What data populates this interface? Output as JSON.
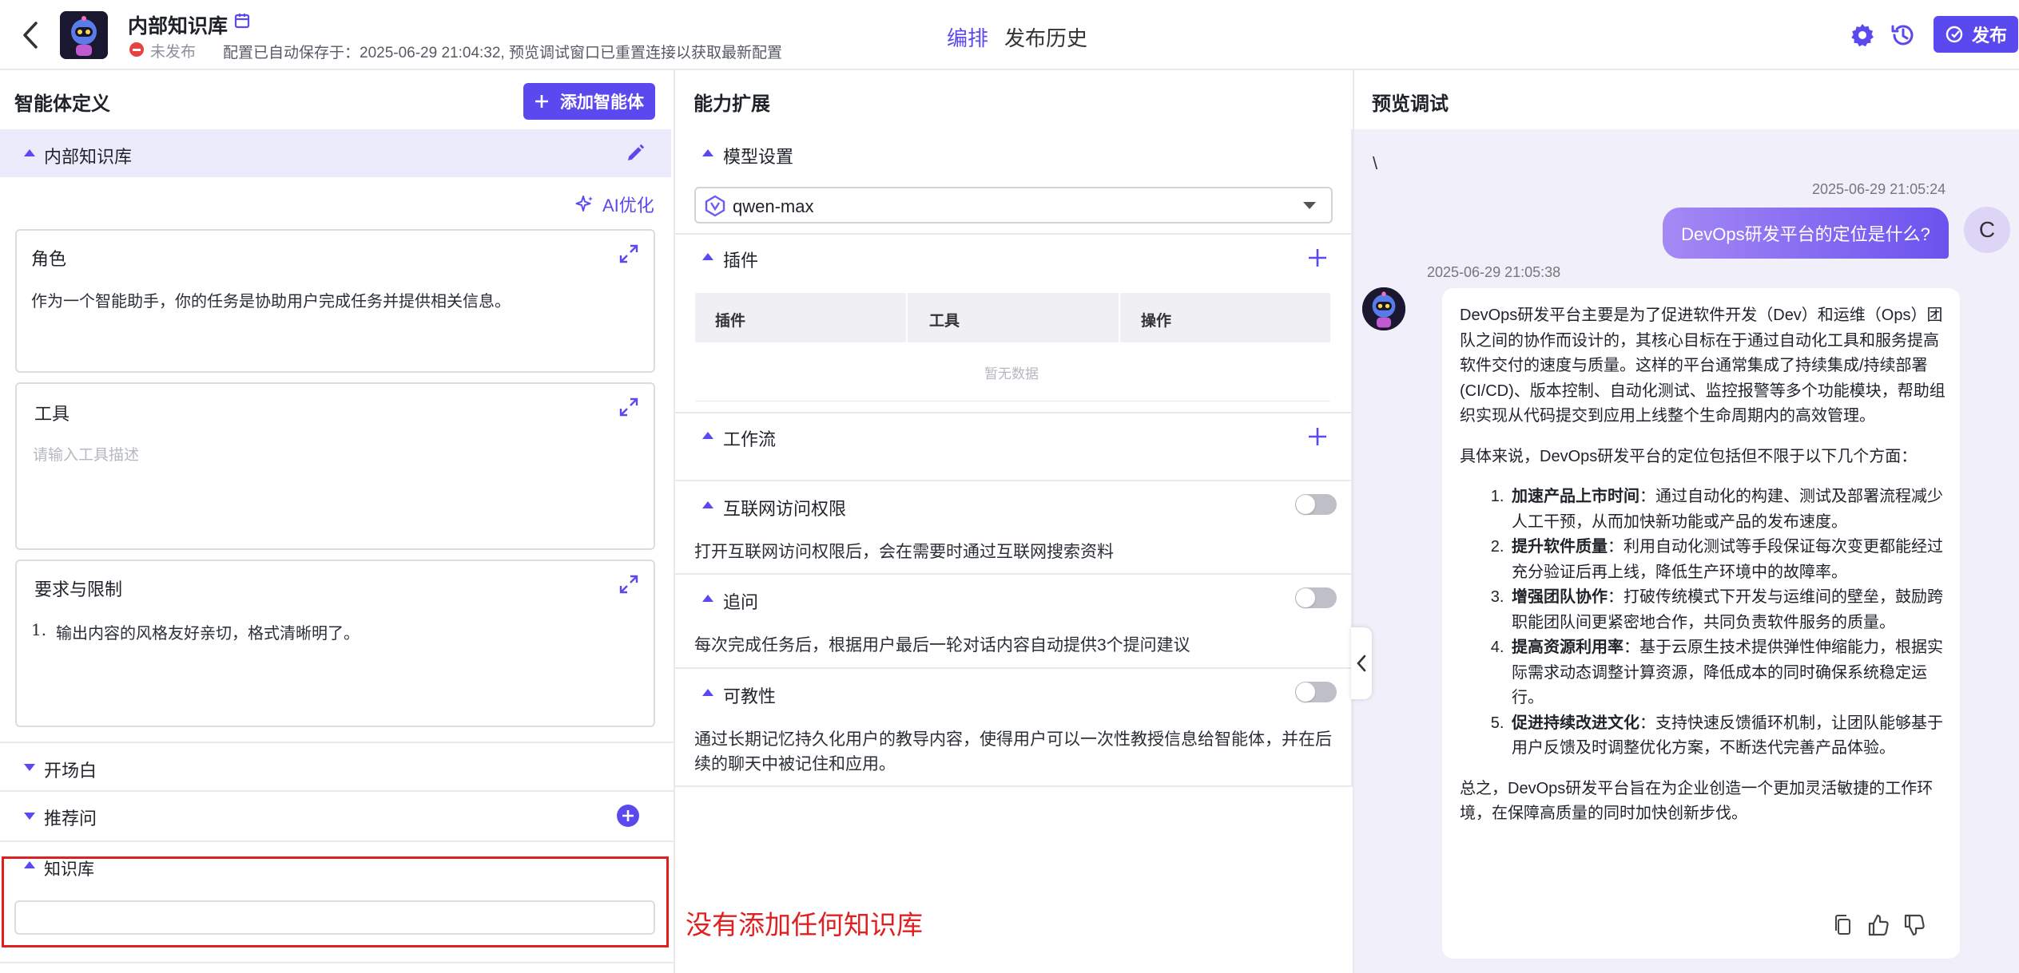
{
  "header": {
    "title": "内部知识库",
    "status": "未发布",
    "autosave": "配置已自动保存于：2025-06-29 21:04:32, 预览调试窗口已重置连接以获取最新配置",
    "tabs": [
      "编排",
      "发布历史"
    ],
    "publish_label": "发布"
  },
  "left": {
    "heading": "智能体定义",
    "add_agent_label": "添加智能体",
    "agent_section_title": "内部知识库",
    "ai_optimize_label": "AI优化",
    "role": {
      "title": "角色",
      "content": "作为一个智能助手，你的任务是协助用户完成任务并提供相关信息。"
    },
    "tools": {
      "title": "工具",
      "placeholder": "请输入工具描述"
    },
    "constraints": {
      "title": "要求与限制",
      "item_number": "1.",
      "item_text": "输出内容的风格友好亲切，格式清晰明了。"
    },
    "opening_label": "开场白",
    "suggested_label": "推荐问",
    "knowledge_label": "知识库",
    "annotation": "没有添加任何知识库"
  },
  "middle": {
    "heading": "能力扩展",
    "model": {
      "title": "模型设置",
      "selected": "qwen-max"
    },
    "plugins": {
      "title": "插件",
      "columns": [
        "插件",
        "工具",
        "操作"
      ],
      "empty_text": "暂无数据"
    },
    "workflow_title": "工作流",
    "internet": {
      "title": "互联网访问权限",
      "desc": "打开互联网访问权限后，会在需要时通过互联网搜索资料",
      "enabled": false
    },
    "followup": {
      "title": "追问",
      "desc": "每次完成任务后，根据用户最后一轮对话内容自动提供3个提问建议",
      "enabled": false
    },
    "teachable": {
      "title": "可教性",
      "desc": "通过长期记忆持久化用户的教导内容，使得用户可以一次性教授信息给智能体，并在后续的聊天中被记住和应用。",
      "enabled": false
    }
  },
  "right": {
    "heading": "预览调试",
    "stray_char": "\\",
    "user_time": "2025-06-29 21:05:24",
    "user_message": "DevOps研发平台的定位是什么?",
    "user_avatar_letter": "C",
    "bot_time": "2025-06-29 21:05:38",
    "answer_intro": "DevOps研发平台主要是为了促进软件开发（Dev）和运维（Ops）团队之间的协作而设计的，其核心目标在于通过自动化工具和服务提高软件交付的速度与质量。这样的平台通常集成了持续集成/持续部署(CI/CD)、版本控制、自动化测试、监控报警等多个功能模块，帮助组织实现从代码提交到应用上线整个生命周期内的高效管理。",
    "answer_lead": "具体来说，DevOps研发平台的定位包括但不限于以下几个方面：",
    "answer_items": [
      {
        "bold": "加速产品上市时间",
        "text": "：通过自动化的构建、测试及部署流程减少人工干预，从而加快新功能或产品的发布速度。"
      },
      {
        "bold": "提升软件质量",
        "text": "：利用自动化测试等手段保证每次变更都能经过充分验证后再上线，降低生产环境中的故障率。"
      },
      {
        "bold": "增强团队协作",
        "text": "：打破传统模式下开发与运维间的壁垒，鼓励跨职能团队间更紧密地合作，共同负责软件服务的质量。"
      },
      {
        "bold": "提高资源利用率",
        "text": "：基于云原生技术提供弹性伸缩能力，根据实际需求动态调整计算资源，降低成本的同时确保系统稳定运行。"
      },
      {
        "bold": "促进持续改进文化",
        "text": "：支持快速反馈循环机制，让团队能够基于用户反馈及时调整优化方案，不断迭代完善产品体验。"
      }
    ],
    "answer_summary": "总之，DevOps研发平台旨在为企业创造一个更加灵活敏捷的工作环境，在保障高质量的同时加快创新步伐。"
  },
  "colors": {
    "accent": "#5b49f0",
    "annotation": "#e02020",
    "status_red": "#e74141"
  },
  "icons": [
    "back-arrow-icon",
    "robot-avatar",
    "calendar-edit-icon",
    "gear-icon",
    "history-icon",
    "publish-icon",
    "plus-icon",
    "edit-pencil-icon",
    "sparkle-icon",
    "expand-icon",
    "qwen-logo-icon",
    "chevron-down-icon",
    "collapse-left-icon",
    "copy-icon",
    "thumbs-up-icon",
    "thumbs-down-icon"
  ]
}
